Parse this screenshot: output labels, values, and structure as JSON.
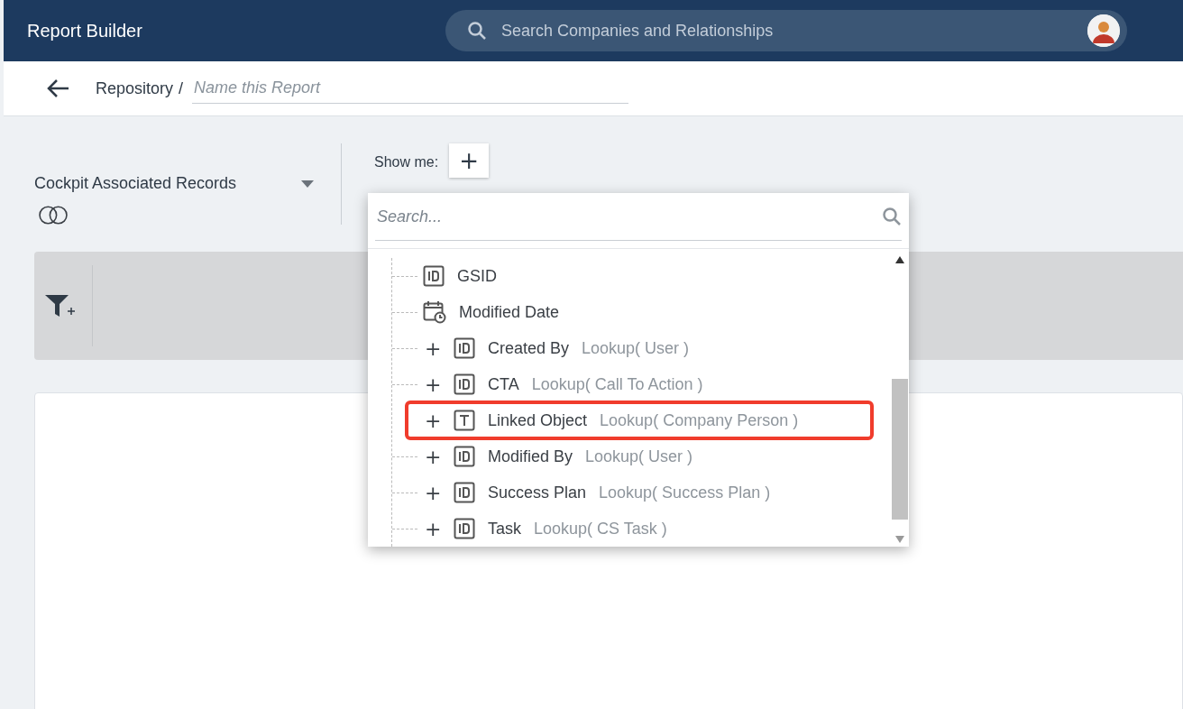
{
  "header": {
    "title": "Report Builder",
    "search": {
      "placeholder": "Search Companies and Relationships"
    }
  },
  "breadcrumb": {
    "parent": "Repository",
    "separator": "/",
    "name_field": {
      "placeholder": "Name this Report"
    }
  },
  "source": {
    "label": "Cockpit Associated Records"
  },
  "show_me": {
    "label": "Show me:",
    "add": "+"
  },
  "field_picker": {
    "search": {
      "placeholder": "Search..."
    },
    "items": [
      {
        "kind": "id",
        "label": "GSID",
        "expandable": false,
        "highlighted": false
      },
      {
        "kind": "date",
        "label": "Modified Date",
        "expandable": false,
        "highlighted": false
      },
      {
        "kind": "id",
        "label": "Created By",
        "type": "Lookup( User )",
        "expandable": true,
        "expand": "+",
        "highlighted": false
      },
      {
        "kind": "id",
        "label": "CTA",
        "type": "Lookup( Call To Action )",
        "expandable": true,
        "expand": "+",
        "highlighted": false
      },
      {
        "kind": "text",
        "label": "Linked Object",
        "type": "Lookup( Company Person )",
        "expandable": true,
        "expand": "+",
        "highlighted": true
      },
      {
        "kind": "id",
        "label": "Modified By",
        "type": "Lookup( User )",
        "expandable": true,
        "expand": "+",
        "highlighted": false
      },
      {
        "kind": "id",
        "label": "Success Plan",
        "type": "Lookup( Success Plan )",
        "expandable": true,
        "expand": "+",
        "highlighted": false
      },
      {
        "kind": "id",
        "label": "Task",
        "type": "Lookup( CS Task )",
        "expandable": true,
        "expand": "+",
        "highlighted": false
      }
    ]
  }
}
